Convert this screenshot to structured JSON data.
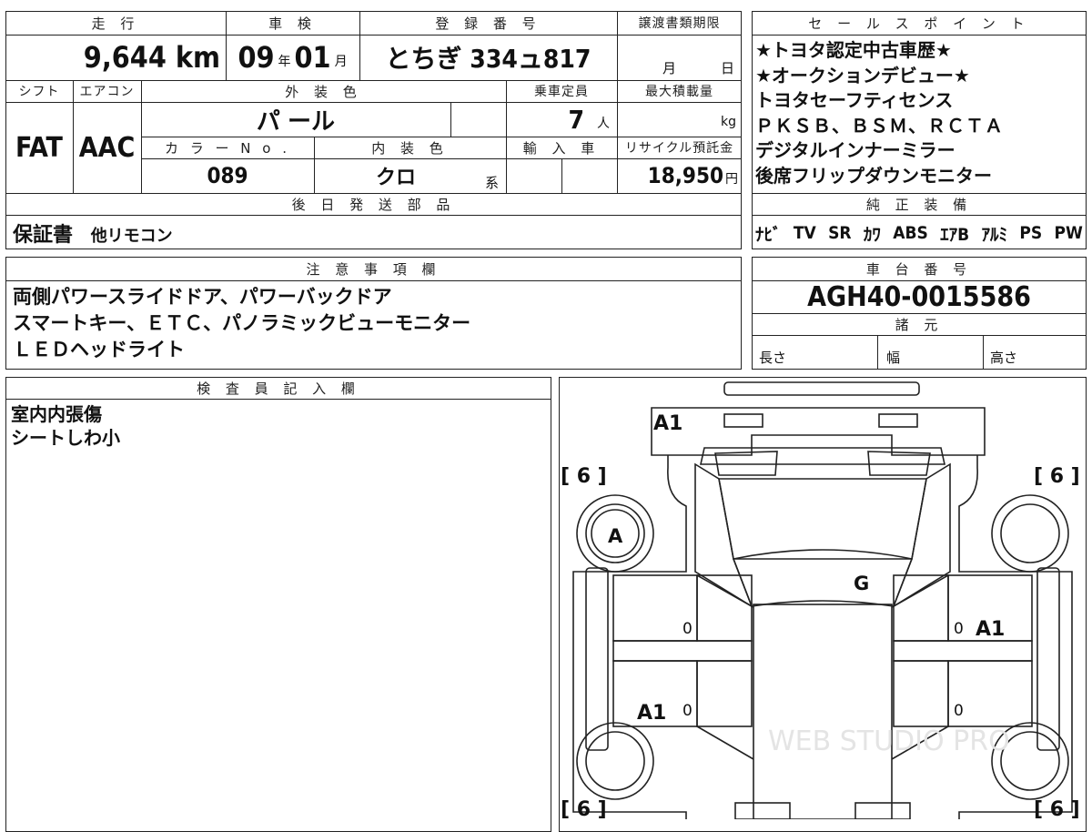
{
  "top_row": {
    "mileage_label": "走 行",
    "mileage_value": "9,644",
    "mileage_unit": "km",
    "inspection_label": "車 検",
    "inspection_year": "09",
    "inspection_year_unit": "年",
    "inspection_month": "01",
    "inspection_month_unit": "月",
    "registration_label": "登 録 番 号",
    "registration_value": "とちぎ 334ュ817",
    "transfer_label": "譲渡書類期限",
    "transfer_month_unit": "月",
    "transfer_day_unit": "日"
  },
  "second_row": {
    "shift_label": "シフト",
    "shift_value": "FAT",
    "aircon_label": "エアコン",
    "aircon_value": "AAC",
    "exterior_label": "外 装 色",
    "exterior_value": "パ ール",
    "capacity_label": "乗車定員",
    "capacity_value": "7",
    "capacity_unit": "人",
    "loadmax_label": "最大積載量",
    "loadmax_unit": "kg",
    "colorno_label": "カ ラ ー N o .",
    "colorno_value": "089",
    "interior_label": "内 装 色",
    "interior_value": "クロ",
    "interior_unit": "系",
    "import_label": "輸 入 車",
    "recycle_label": "リサイクル預託金",
    "recycle_value": "18,950",
    "recycle_unit": "円"
  },
  "parts": {
    "label": "後 日 発 送 部 品",
    "value_main": "保証書",
    "value_sub": "他リモコン"
  },
  "sales_points": {
    "label": "セ ー ル ス ポ イ ン ト",
    "lines": [
      "★トヨタ認定中古車歴★",
      "★オークションデビュー★",
      "トヨタセーフティセンス",
      "ＰＫＳＢ、ＢＳＭ、ＲＣＴＡ",
      "デジタルインナーミラー",
      "後席フリップダウンモニター"
    ]
  },
  "equipment": {
    "label": "純 正 装 備",
    "items": [
      "ﾅﾋﾞ",
      "TV",
      "SR",
      "ｶﾜ",
      "ABS",
      "ｴｱB",
      "ｱﾙﾐ",
      "PS",
      "PW"
    ]
  },
  "notes": {
    "label": "注 意 事 項 欄",
    "lines": [
      "両側パワースライドドア、パワーバックドア",
      "スマートキー、ＥＴＣ、パノラミックビューモニター",
      "ＬＥＤヘッドライト"
    ]
  },
  "chassis": {
    "label": "車 台 番 号",
    "value": "AGH40-0015586"
  },
  "specs": {
    "label": "諸 元",
    "length_label": "長さ",
    "width_label": "幅",
    "height_label": "高さ"
  },
  "inspector": {
    "label": "検 査 員 記 入 欄",
    "lines": [
      "室内内張傷",
      "シートしわ小"
    ]
  },
  "diagram": {
    "marks": {
      "rear_a1": "A1",
      "tire_tl": "[ 6 ]",
      "tire_tr": "[ 6 ]",
      "tire_bl": "[ 6 ]",
      "tire_br": "[ 6 ]",
      "rear_left_a": "A",
      "rear_glass_g": "G",
      "right_door_a1": "A1",
      "left_door_a1": "A1",
      "door_zero_1": "0",
      "door_zero_2": "0",
      "door_zero_3": "0",
      "door_zero_4": "0"
    },
    "watermark": "WEB STUDIO PRO"
  }
}
